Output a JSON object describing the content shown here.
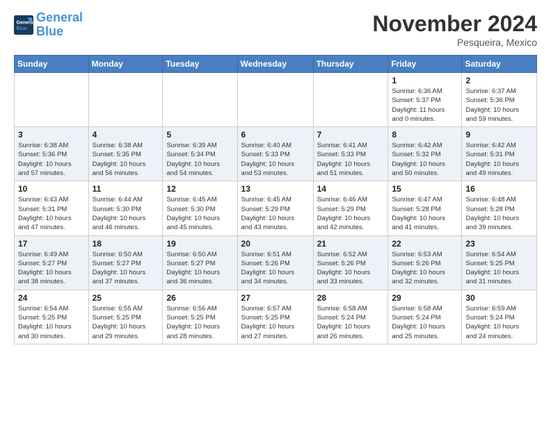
{
  "header": {
    "logo_line1": "General",
    "logo_line2": "Blue",
    "month": "November 2024",
    "location": "Pesqueira, Mexico"
  },
  "weekdays": [
    "Sunday",
    "Monday",
    "Tuesday",
    "Wednesday",
    "Thursday",
    "Friday",
    "Saturday"
  ],
  "weeks": [
    [
      {
        "day": "",
        "info": ""
      },
      {
        "day": "",
        "info": ""
      },
      {
        "day": "",
        "info": ""
      },
      {
        "day": "",
        "info": ""
      },
      {
        "day": "",
        "info": ""
      },
      {
        "day": "1",
        "info": "Sunrise: 6:36 AM\nSunset: 5:37 PM\nDaylight: 11 hours\nand 0 minutes."
      },
      {
        "day": "2",
        "info": "Sunrise: 6:37 AM\nSunset: 5:36 PM\nDaylight: 10 hours\nand 59 minutes."
      }
    ],
    [
      {
        "day": "3",
        "info": "Sunrise: 6:38 AM\nSunset: 5:36 PM\nDaylight: 10 hours\nand 57 minutes."
      },
      {
        "day": "4",
        "info": "Sunrise: 6:38 AM\nSunset: 5:35 PM\nDaylight: 10 hours\nand 56 minutes."
      },
      {
        "day": "5",
        "info": "Sunrise: 6:39 AM\nSunset: 5:34 PM\nDaylight: 10 hours\nand 54 minutes."
      },
      {
        "day": "6",
        "info": "Sunrise: 6:40 AM\nSunset: 5:33 PM\nDaylight: 10 hours\nand 53 minutes."
      },
      {
        "day": "7",
        "info": "Sunrise: 6:41 AM\nSunset: 5:33 PM\nDaylight: 10 hours\nand 51 minutes."
      },
      {
        "day": "8",
        "info": "Sunrise: 6:42 AM\nSunset: 5:32 PM\nDaylight: 10 hours\nand 50 minutes."
      },
      {
        "day": "9",
        "info": "Sunrise: 6:42 AM\nSunset: 5:31 PM\nDaylight: 10 hours\nand 49 minutes."
      }
    ],
    [
      {
        "day": "10",
        "info": "Sunrise: 6:43 AM\nSunset: 5:31 PM\nDaylight: 10 hours\nand 47 minutes."
      },
      {
        "day": "11",
        "info": "Sunrise: 6:44 AM\nSunset: 5:30 PM\nDaylight: 10 hours\nand 46 minutes."
      },
      {
        "day": "12",
        "info": "Sunrise: 6:45 AM\nSunset: 5:30 PM\nDaylight: 10 hours\nand 45 minutes."
      },
      {
        "day": "13",
        "info": "Sunrise: 6:45 AM\nSunset: 5:29 PM\nDaylight: 10 hours\nand 43 minutes."
      },
      {
        "day": "14",
        "info": "Sunrise: 6:46 AM\nSunset: 5:29 PM\nDaylight: 10 hours\nand 42 minutes."
      },
      {
        "day": "15",
        "info": "Sunrise: 6:47 AM\nSunset: 5:28 PM\nDaylight: 10 hours\nand 41 minutes."
      },
      {
        "day": "16",
        "info": "Sunrise: 6:48 AM\nSunset: 5:28 PM\nDaylight: 10 hours\nand 39 minutes."
      }
    ],
    [
      {
        "day": "17",
        "info": "Sunrise: 6:49 AM\nSunset: 5:27 PM\nDaylight: 10 hours\nand 38 minutes."
      },
      {
        "day": "18",
        "info": "Sunrise: 6:50 AM\nSunset: 5:27 PM\nDaylight: 10 hours\nand 37 minutes."
      },
      {
        "day": "19",
        "info": "Sunrise: 6:50 AM\nSunset: 5:27 PM\nDaylight: 10 hours\nand 36 minutes."
      },
      {
        "day": "20",
        "info": "Sunrise: 6:51 AM\nSunset: 5:26 PM\nDaylight: 10 hours\nand 34 minutes."
      },
      {
        "day": "21",
        "info": "Sunrise: 6:52 AM\nSunset: 5:26 PM\nDaylight: 10 hours\nand 33 minutes."
      },
      {
        "day": "22",
        "info": "Sunrise: 6:53 AM\nSunset: 5:26 PM\nDaylight: 10 hours\nand 32 minutes."
      },
      {
        "day": "23",
        "info": "Sunrise: 6:54 AM\nSunset: 5:25 PM\nDaylight: 10 hours\nand 31 minutes."
      }
    ],
    [
      {
        "day": "24",
        "info": "Sunrise: 6:54 AM\nSunset: 5:25 PM\nDaylight: 10 hours\nand 30 minutes."
      },
      {
        "day": "25",
        "info": "Sunrise: 6:55 AM\nSunset: 5:25 PM\nDaylight: 10 hours\nand 29 minutes."
      },
      {
        "day": "26",
        "info": "Sunrise: 6:56 AM\nSunset: 5:25 PM\nDaylight: 10 hours\nand 28 minutes."
      },
      {
        "day": "27",
        "info": "Sunrise: 6:57 AM\nSunset: 5:25 PM\nDaylight: 10 hours\nand 27 minutes."
      },
      {
        "day": "28",
        "info": "Sunrise: 6:58 AM\nSunset: 5:24 PM\nDaylight: 10 hours\nand 26 minutes."
      },
      {
        "day": "29",
        "info": "Sunrise: 6:58 AM\nSunset: 5:24 PM\nDaylight: 10 hours\nand 25 minutes."
      },
      {
        "day": "30",
        "info": "Sunrise: 6:59 AM\nSunset: 5:24 PM\nDaylight: 10 hours\nand 24 minutes."
      }
    ]
  ]
}
